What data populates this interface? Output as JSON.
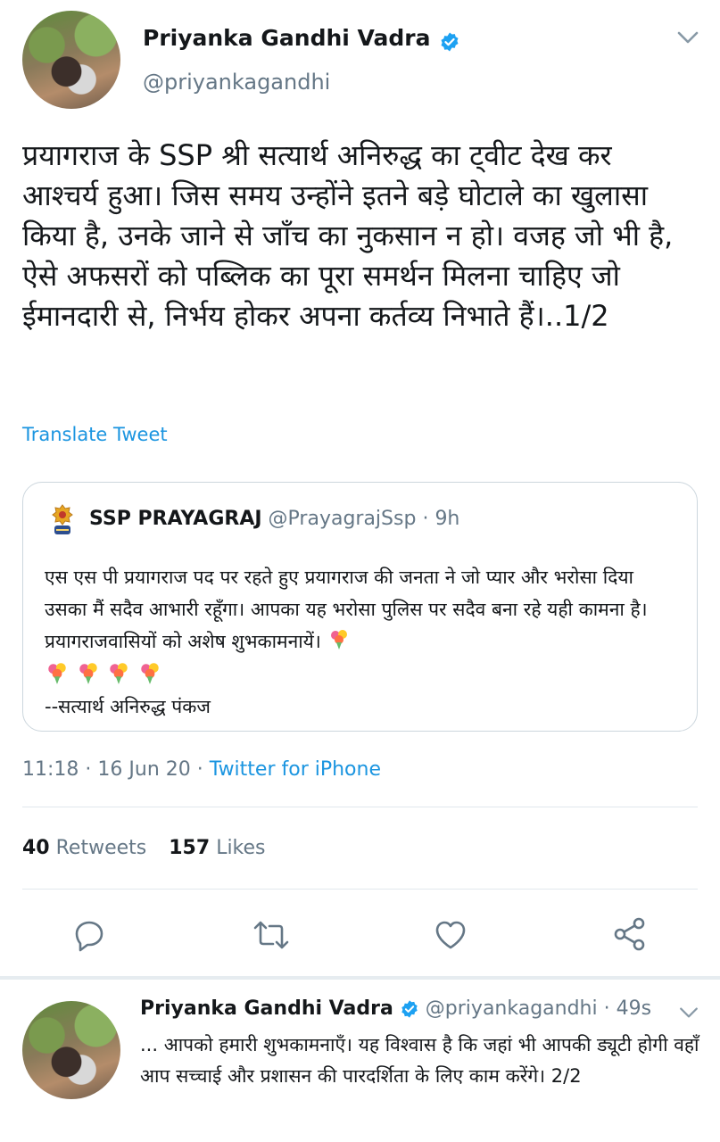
{
  "main_tweet": {
    "author_name": "Priyanka Gandhi Vadra",
    "handle": "@priyankagandhi",
    "text": "प्रयागराज के SSP श्री सत्यार्थ अनिरुद्ध का ट्वीट देख कर आश्चर्य हुआ। जिस समय उन्होंने इतने बड़े घोटाले का खुलासा किया है, उनके जाने से जाँच का नुकसान न हो। वजह जो भी है, ऐसे अफसरों को पब्लिक का पूरा समर्थन मिलना चाहिए जो ईमानदारी से, निर्भय होकर अपना कर्तव्य निभाते हैं।..1/2",
    "translate_label": "Translate Tweet",
    "time": "11:18",
    "date": "16 Jun 20",
    "source": "Twitter for iPhone",
    "retweets_count": "40",
    "retweets_label": "Retweets",
    "likes_count": "157",
    "likes_label": "Likes"
  },
  "quoted_tweet": {
    "author_name": "SSP PRAYAGRAJ",
    "handle": "@PrayagrajSsp",
    "age": "9h",
    "text": "एस एस पी प्रयागराज पद पर रहते हुए प्रयागराज की जनता ने जो प्यार और भरोसा दिया उसका मैं सदैव आभारी रहूँगा। आपका यह भरोसा पुलिस पर सदैव बना रहे यही कामना है। प्रयागराजवासियों को अशेष शुभकामनायें।",
    "signature": "--सत्यार्थ अनिरुद्ध पंकज"
  },
  "reply_tweet": {
    "author_name": "Priyanka Gandhi Vadra",
    "handle": "@priyankagandhi",
    "age": "49s",
    "text": "... आपको हमारी शुभकामनाएँ। यह विश्वास है कि जहां भी आपकी ड्यूटी होगी वहाँ आप सच्चाई और प्रशासन की पारदर्शिता के लिए काम करेंगे। 2/2"
  },
  "icons": [
    "chevron-down-icon",
    "verified-icon",
    "police-emblem-icon",
    "bouquet-icon",
    "reply-icon",
    "retweet-icon",
    "like-icon",
    "share-icon"
  ],
  "colors": {
    "link": "#1b95e0",
    "secondary_text": "#657786",
    "border": "#ccd6dd"
  }
}
